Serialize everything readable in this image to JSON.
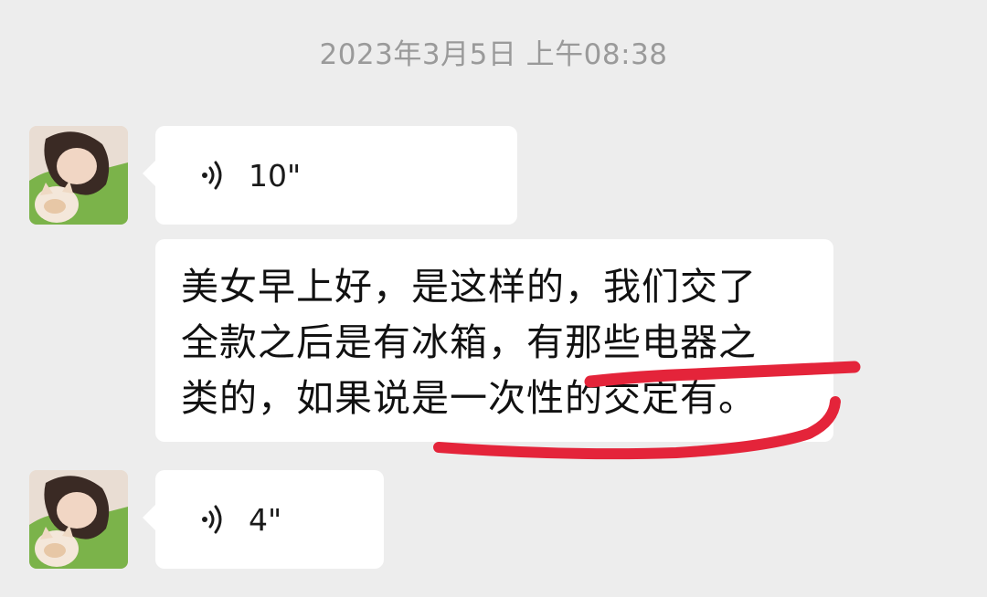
{
  "timestamp": "2023年3月5日 上午08:38",
  "messages": [
    {
      "type": "voice",
      "duration": "10\""
    },
    {
      "type": "text",
      "lines": [
        "美女早上好，是这样的，我们交了",
        "全款之后是有冰箱，有那些电器之",
        "类的，如果说是一次性的交定有。"
      ]
    },
    {
      "type": "voice",
      "duration": "4\""
    }
  ],
  "colors": {
    "background": "#ededed",
    "bubble": "#ffffff",
    "annotation_stroke": "#e4243a",
    "timestamp": "#9a9a9a"
  },
  "icons": {
    "voice": "voice-wave-icon",
    "avatar": "avatar"
  }
}
